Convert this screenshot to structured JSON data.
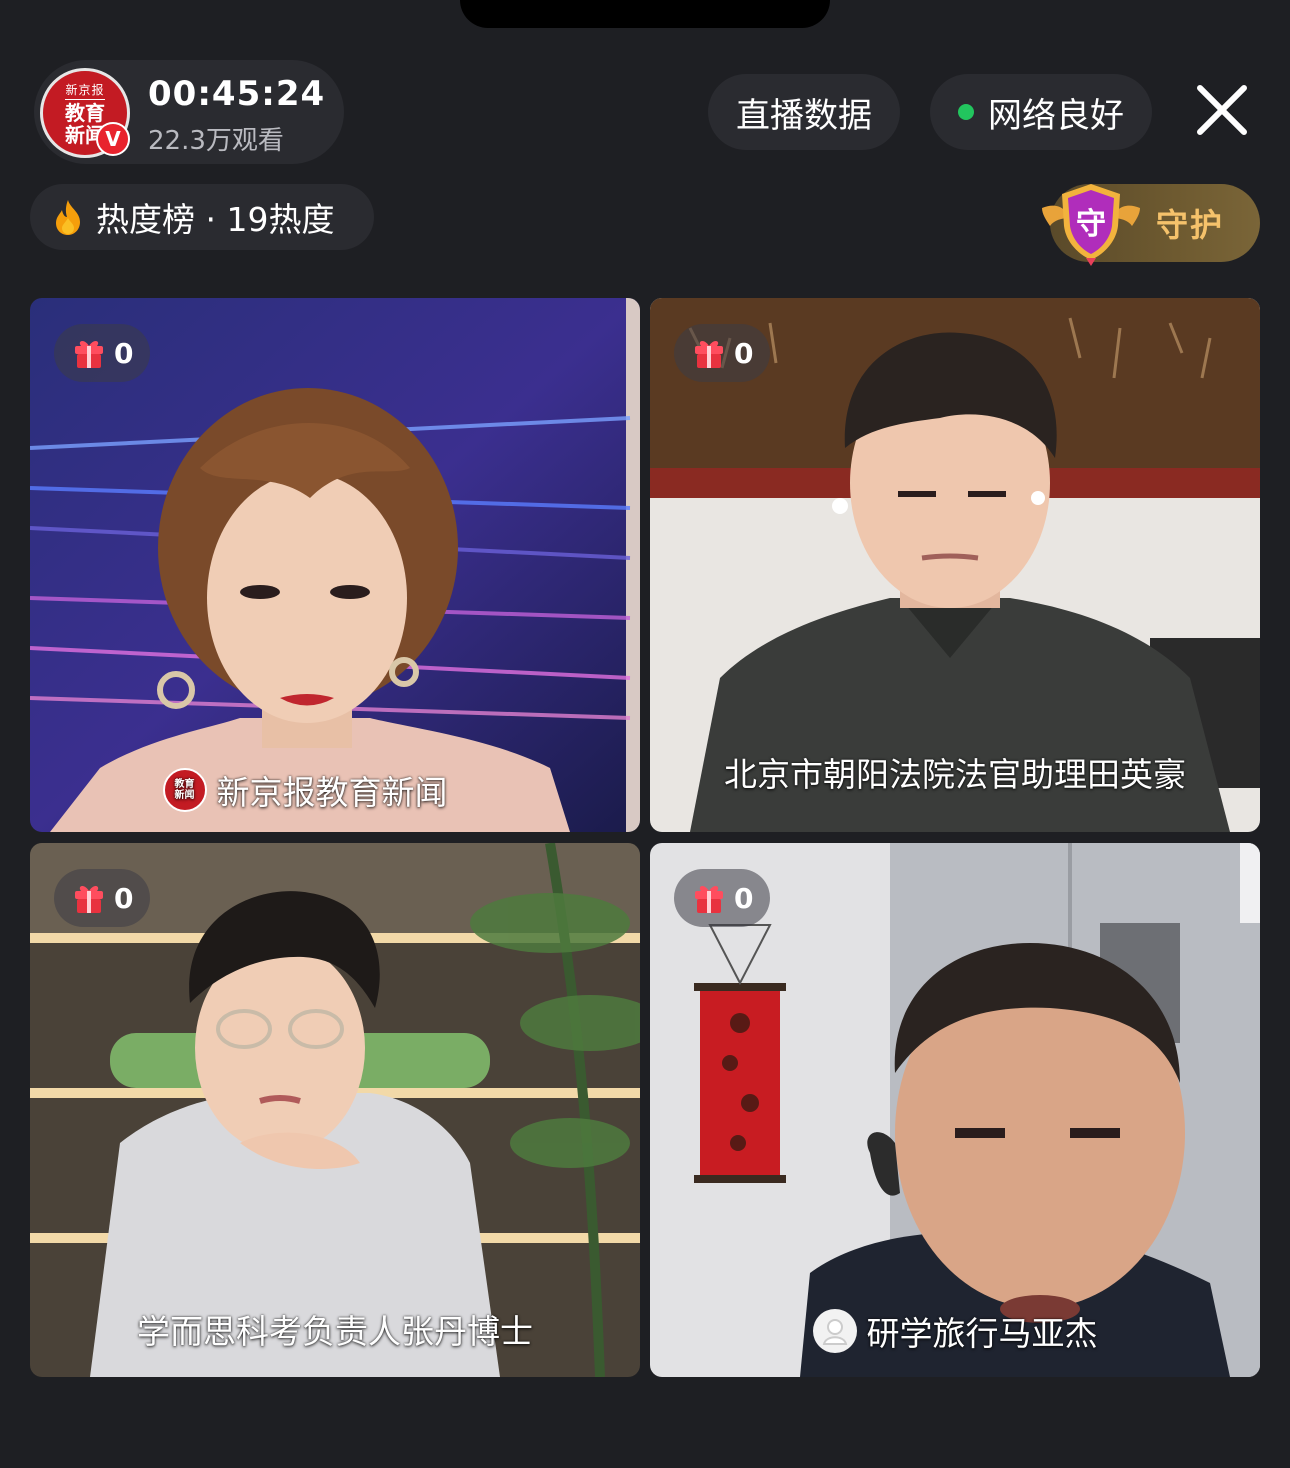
{
  "header": {
    "host_logo_top": "新京报",
    "host_logo_main": "教育新闻",
    "verified_badge": "V",
    "timer": "00:45:24",
    "viewers": "22.3万观看",
    "live_data_button": "直播数据",
    "network_status": "网络良好",
    "network_color": "#22c55e"
  },
  "hot": {
    "label": "热度榜 · 19热度"
  },
  "guard": {
    "badge_char": "守",
    "label": "守护"
  },
  "tiles": [
    {
      "gifts": "0",
      "name": "新京报教育新闻",
      "avatar_text": "教育新闻"
    },
    {
      "gifts": "0",
      "name": "北京市朝阳法院法官助理田英豪"
    },
    {
      "gifts": "0",
      "name": "学而思科考负责人张丹博士"
    },
    {
      "gifts": "0",
      "name": "研学旅行马亚杰"
    }
  ],
  "icons": {
    "close": "close-icon",
    "flame": "flame-icon",
    "gift": "gift-icon",
    "shield": "shield-icon",
    "user": "user-icon"
  }
}
